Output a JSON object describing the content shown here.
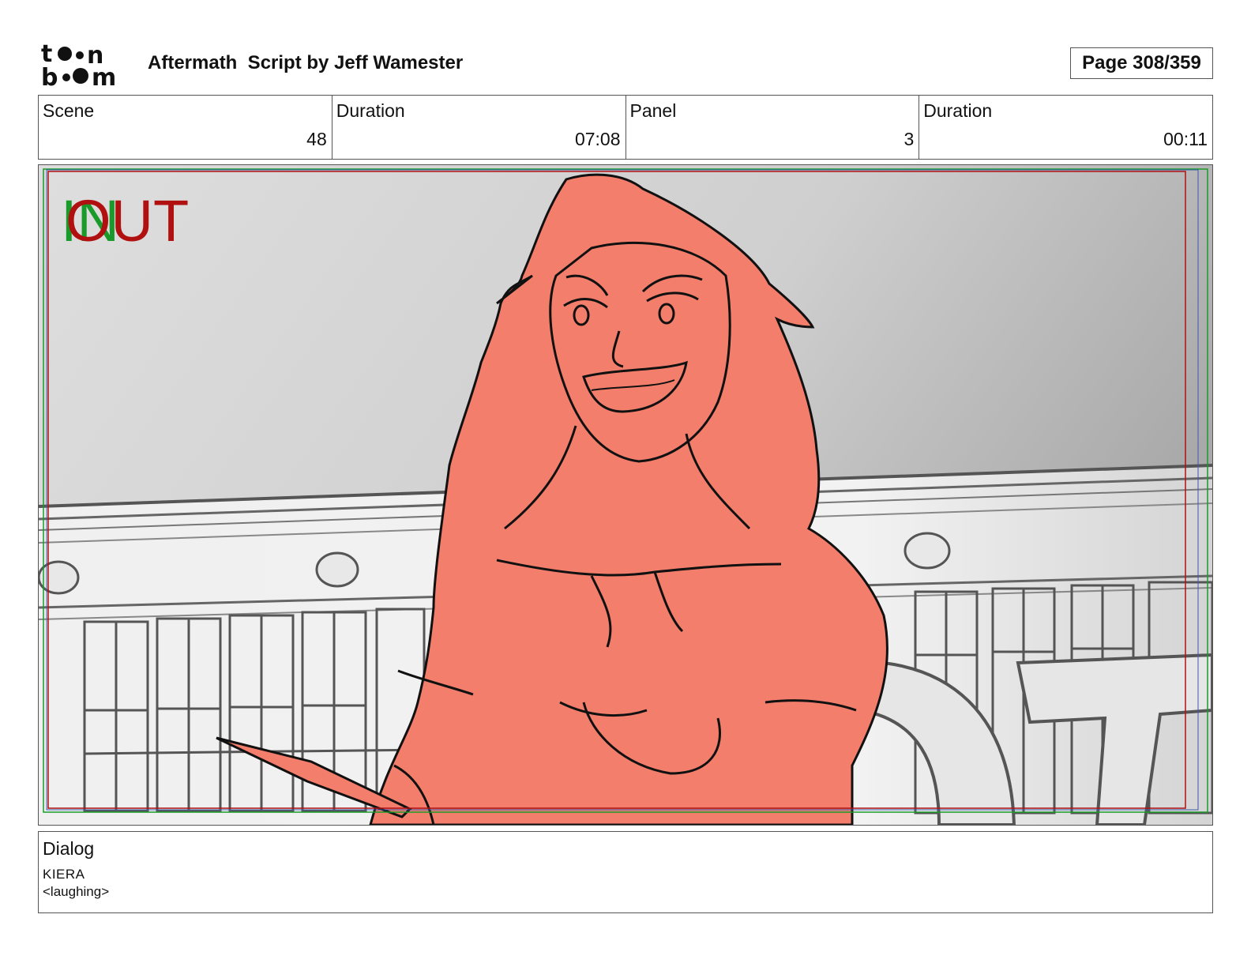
{
  "header": {
    "logo_text": "toon boom",
    "title": "Aftermath  Script by Jeff Wamester",
    "page": "Page 308/359"
  },
  "meta": {
    "scene_label": "Scene",
    "scene_value": "48",
    "scene_duration_label": "Duration",
    "scene_duration_value": "07:08",
    "panel_label": "Panel",
    "panel_value": "3",
    "panel_duration_label": "Duration",
    "panel_duration_value": "00:11"
  },
  "panel": {
    "in_marker": "IN",
    "out_marker": "OUT",
    "colors": {
      "in_green": "#1a9a2a",
      "out_red": "#b01010",
      "character_fill": "#f47e6c"
    }
  },
  "dialog": {
    "label": "Dialog",
    "speaker": "KIERA",
    "line": "<laughing>"
  }
}
